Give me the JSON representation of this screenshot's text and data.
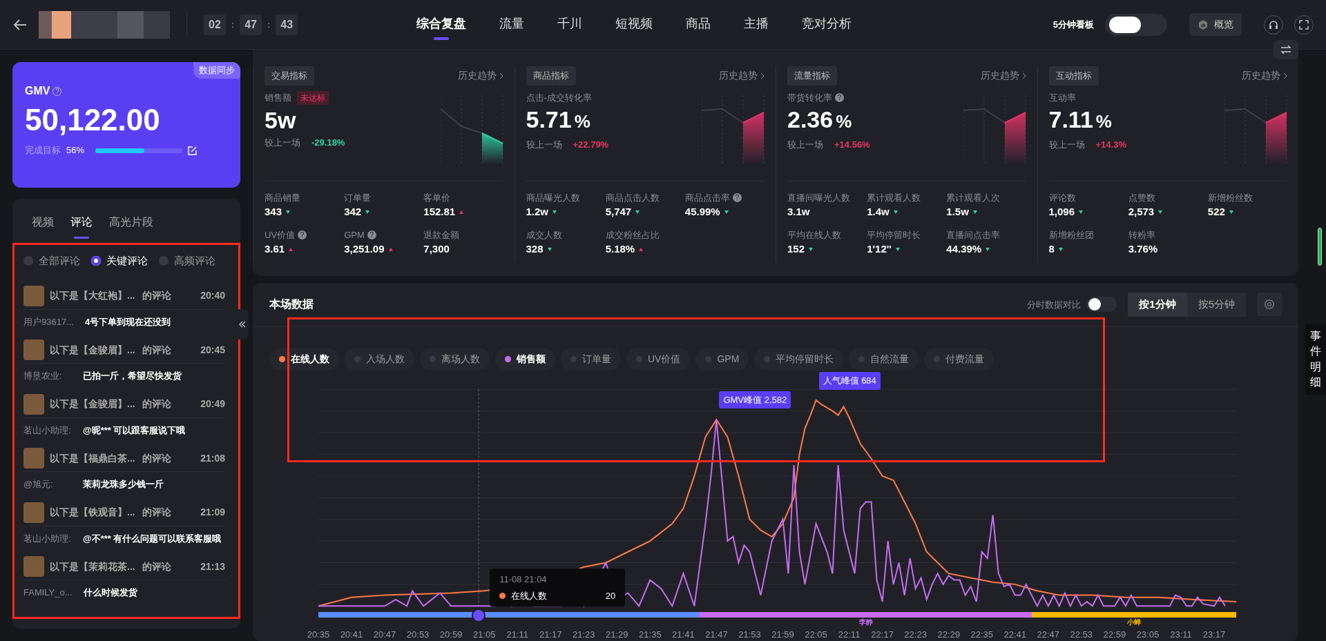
{
  "header": {
    "timer": [
      "02",
      ":",
      "47",
      ":",
      "43"
    ],
    "tabs": [
      {
        "label": "综合复盘",
        "selected": true
      },
      {
        "label": "流量",
        "selected": false
      },
      {
        "label": "千川",
        "selected": false
      },
      {
        "label": "短视频",
        "selected": false
      },
      {
        "label": "商品",
        "selected": false
      },
      {
        "label": "主播",
        "selected": false
      },
      {
        "label": "竞对分析",
        "selected": false
      }
    ],
    "board_toggle": {
      "label": "5分钟看板",
      "on": false
    },
    "overview_button": "概览"
  },
  "gmv_card": {
    "badge": "数据同步",
    "title": "GMV",
    "help": "?",
    "value": "50,122.00",
    "target_label": "完成目标",
    "target_percent": "56%",
    "level": 0.56
  },
  "comment_panel": {
    "tabs": [
      {
        "label": "视频",
        "selected": false
      },
      {
        "label": "评论",
        "selected": true
      },
      {
        "label": "高光片段",
        "selected": false
      }
    ],
    "highlighted": true,
    "filters": [
      {
        "label": "全部评论",
        "selected": false
      },
      {
        "label": "关键评论",
        "selected": true
      },
      {
        "label": "高频评论",
        "selected": false
      }
    ],
    "comments": [
      {
        "product": "以下是【大红袍】...",
        "suffix": "的评论",
        "time": "20:40",
        "user": "用户93617...",
        "text": "4号下单到现在还没到"
      },
      {
        "product": "以下是【金骏眉】...",
        "suffix": "的评论",
        "time": "20:45",
        "user": "博垦农业:",
        "text": "已拍一斤，希望尽快发货"
      },
      {
        "product": "以下是【金骏眉】...",
        "suffix": "的评论",
        "time": "20:49",
        "user": "茗山小助理:",
        "text": "@昵*** 可以跟客服说下哦"
      },
      {
        "product": "以下是【福鼎白茶...",
        "suffix": "的评论",
        "time": "21:08",
        "user": "@旭元:",
        "text": "茉莉龙珠多少钱一斤"
      },
      {
        "product": "以下是【铁观音】...",
        "suffix": "的评论",
        "time": "21:09",
        "user": "茗山小助理:",
        "text": "@不*** 有什么问题可以联系客服哦"
      },
      {
        "product": "以下是【茉莉花茶...",
        "suffix": "的评论",
        "time": "21:13",
        "user": "FAMILY_o...",
        "text": "什么时候发货"
      }
    ]
  },
  "metric_groups": [
    {
      "tag": "交易指标",
      "history": "历史趋势",
      "title": "销售额",
      "badge": "未达标",
      "value": "5w",
      "compare_label": "较上一场",
      "change": "-29.18%",
      "rising": false,
      "items": [
        {
          "label": "商品销量",
          "value": "343",
          "rising": false
        },
        {
          "label": "订单量",
          "value": "342",
          "rising": false
        },
        {
          "label": "客单价",
          "value": "152.81",
          "rising": true
        },
        {
          "label": "UV价值",
          "help": "?",
          "value": "3.61",
          "rising": true
        },
        {
          "label": "GPM",
          "help": "?",
          "value": "3,251.09",
          "rising": true
        },
        {
          "label": "退款金额",
          "value": "7,300"
        }
      ]
    },
    {
      "tag": "商品指标",
      "history": "历史趋势",
      "title": "点击-成交转化率",
      "value": "5.71",
      "unit": "%",
      "compare_label": "较上一场",
      "change": "+22.79%",
      "rising": true,
      "items": [
        {
          "label": "商品曝光人数",
          "value": "1.2w",
          "rising": false
        },
        {
          "label": "商品点击人数",
          "value": "5,747",
          "rising": false
        },
        {
          "label": "商品点击率",
          "help": "?",
          "value": "45.99%",
          "rising": false
        },
        {
          "label": "成交人数",
          "value": "328",
          "rising": false
        },
        {
          "label": "成交粉丝占比",
          "value": "5.18%",
          "rising": true
        }
      ]
    },
    {
      "tag": "流量指标",
      "history": "历史趋势",
      "title": "带货转化率",
      "help": "?",
      "value": "2.36",
      "unit": "%",
      "compare_label": "较上一场",
      "change": "+14.56%",
      "rising": true,
      "items": [
        {
          "label": "直播间曝光人数",
          "value": "3.1w"
        },
        {
          "label": "累计观看人数",
          "value": "1.4w",
          "rising": false
        },
        {
          "label": "累计观看人次",
          "value": "1.5w",
          "rising": false
        },
        {
          "label": "平均在线人数",
          "value": "152",
          "rising": false
        },
        {
          "label": "平均停留时长",
          "value": "1'12''",
          "rising": false
        },
        {
          "label": "直播间点击率",
          "value": "44.39%",
          "rising": false
        }
      ]
    },
    {
      "tag": "互动指标",
      "history": "历史趋势",
      "title": "互动率",
      "value": "7.11",
      "unit": "%",
      "compare_label": "较上一场",
      "change": "+14.3%",
      "rising": true,
      "items": [
        {
          "label": "评论数",
          "value": "1,096",
          "rising": false
        },
        {
          "label": "点赞数",
          "value": "2,573",
          "rising": false
        },
        {
          "label": "新增粉丝数",
          "value": "522",
          "rising": false
        },
        {
          "label": "新增粉丝团",
          "value": "8",
          "rising": false
        },
        {
          "label": "转粉率",
          "value": "3.76%"
        }
      ]
    }
  ],
  "chart_panel": {
    "title": "本场数据",
    "compare_toggle": {
      "label": "分时数据对比",
      "on": false
    },
    "intervals": [
      {
        "label": "按1分钟",
        "selected": true
      },
      {
        "label": "按5分钟",
        "selected": false
      }
    ],
    "highlighted": true,
    "legend": [
      {
        "label": "在线人数",
        "selected": true,
        "color": "#ff7a45"
      },
      {
        "label": "入场人数",
        "selected": false,
        "color": "#3a3b42"
      },
      {
        "label": "离场人数",
        "selected": false,
        "color": "#3a3b42"
      },
      {
        "label": "销售额",
        "selected": true,
        "color": "#c86cf0"
      },
      {
        "label": "订单量",
        "selected": false,
        "color": "#3a3b42"
      },
      {
        "label": "UV价值",
        "selected": false,
        "color": "#3a3b42"
      },
      {
        "label": "GPM",
        "selected": false,
        "color": "#3a3b42"
      },
      {
        "label": "平均停留时长",
        "selected": false,
        "color": "#3a3b42"
      },
      {
        "label": "自然流量",
        "selected": false,
        "color": "#3a3b42"
      },
      {
        "label": "付费流量",
        "selected": false,
        "color": "#3a3b42"
      }
    ],
    "peaks": [
      {
        "label": "GMV峰值 2,582"
      },
      {
        "label": "人气峰值 684"
      }
    ],
    "hosts": [
      {
        "color": "#5b8cff"
      },
      {
        "label": "李静",
        "color": "#c86cf0"
      },
      {
        "label": "小蝉",
        "color": "#f5b800"
      }
    ],
    "x_labels": [
      "20:35",
      "20:41",
      "20:47",
      "20:53",
      "20:59",
      "21:05",
      "21:11",
      "21:17",
      "21:23",
      "21:29",
      "21:35",
      "21:41",
      "21:47",
      "21:53",
      "21:59",
      "22:05",
      "22:11",
      "22:17",
      "22:23",
      "22:29",
      "22:35",
      "22:41",
      "22:47",
      "22:53",
      "22:59",
      "23:05",
      "23:11",
      "23:17"
    ],
    "tooltip": {
      "time": "11-08 21:04",
      "rows": [
        {
          "label": "在线人数",
          "value": "20",
          "color": "#ff7a45"
        }
      ]
    }
  },
  "event_tab": "事件明细"
}
